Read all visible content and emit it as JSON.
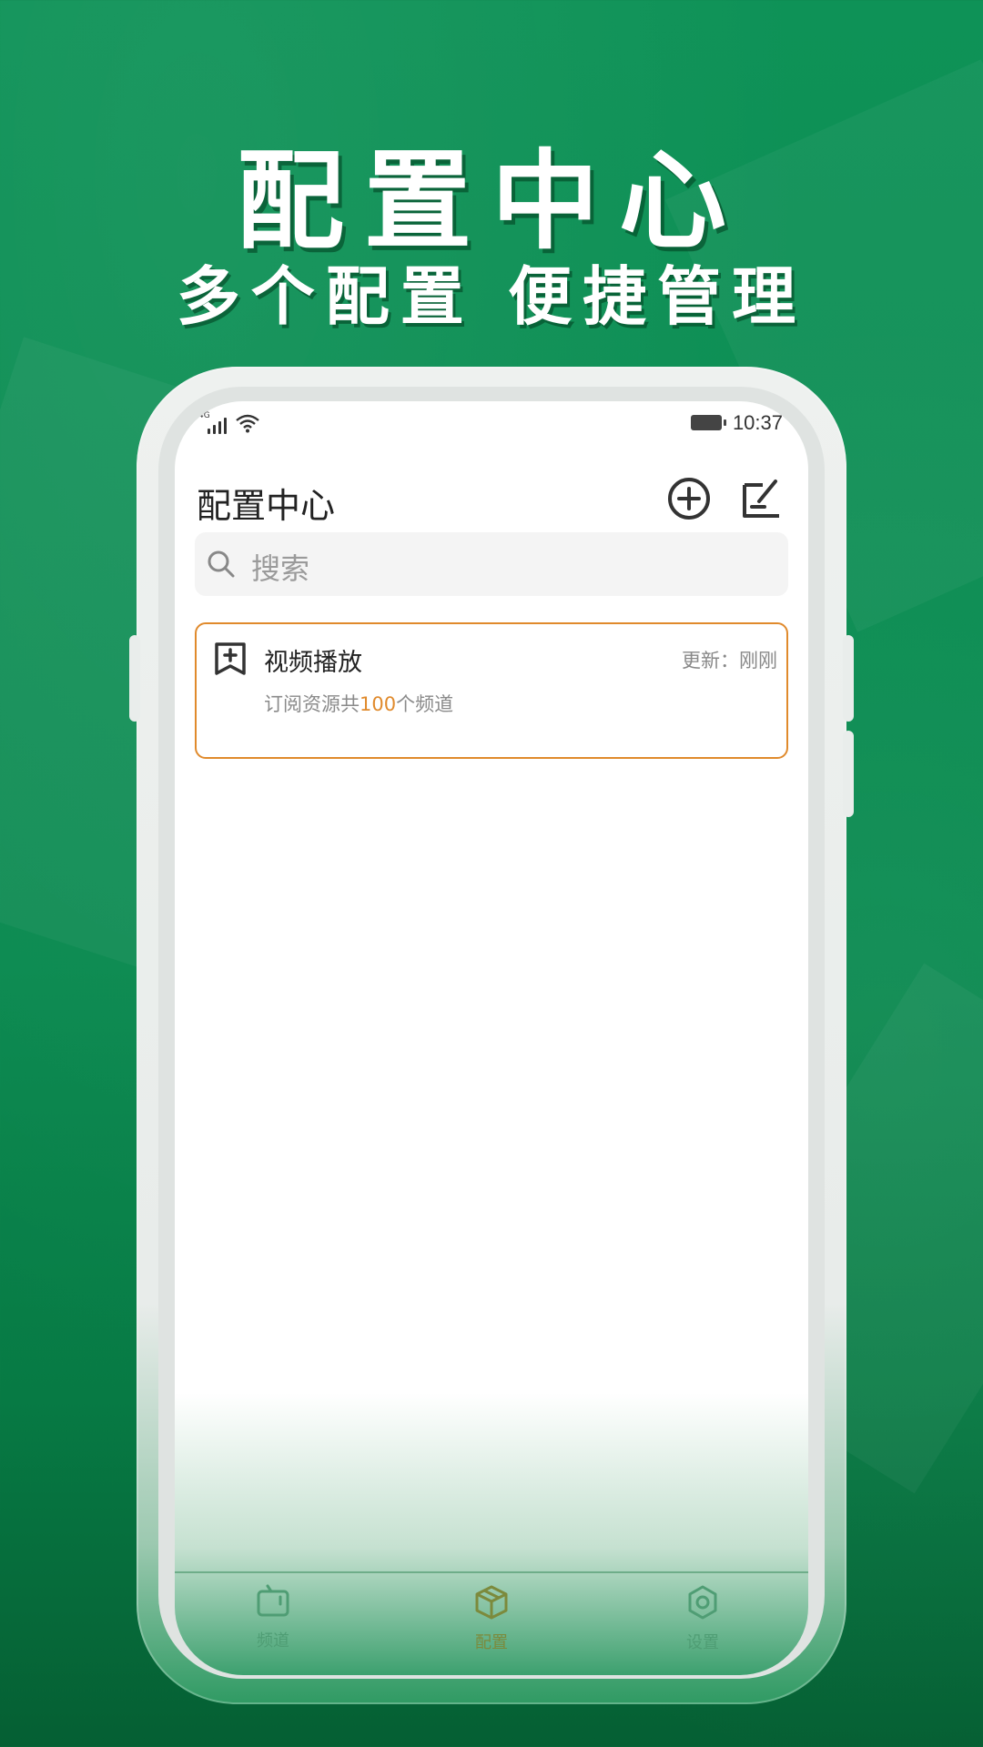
{
  "promo": {
    "title": "配置中心",
    "subtitle": "多个配置 便捷管理"
  },
  "status_bar": {
    "network": "4G",
    "time": "10:37"
  },
  "header": {
    "title": "配置中心",
    "add_icon": "add-circle-icon",
    "edit_icon": "edit-icon"
  },
  "search": {
    "placeholder": "搜索",
    "icon": "search-icon"
  },
  "configs": [
    {
      "icon": "bookmark-plus-icon",
      "name": "视频播放",
      "updated": "更新：刚刚",
      "desc_prefix": "订阅资源共",
      "channel_count": "100",
      "desc_suffix": "个频道"
    }
  ],
  "tabs": [
    {
      "label": "频道",
      "icon": "tv-icon",
      "active": false
    },
    {
      "label": "配置",
      "icon": "box-icon",
      "active": true
    },
    {
      "label": "设置",
      "icon": "gear-icon",
      "active": false
    }
  ],
  "colors": {
    "background": "#0a8a50",
    "accent": "#e08a2c",
    "active_tab": "#7c8a3c",
    "inactive_tab": "#4f9d74"
  }
}
